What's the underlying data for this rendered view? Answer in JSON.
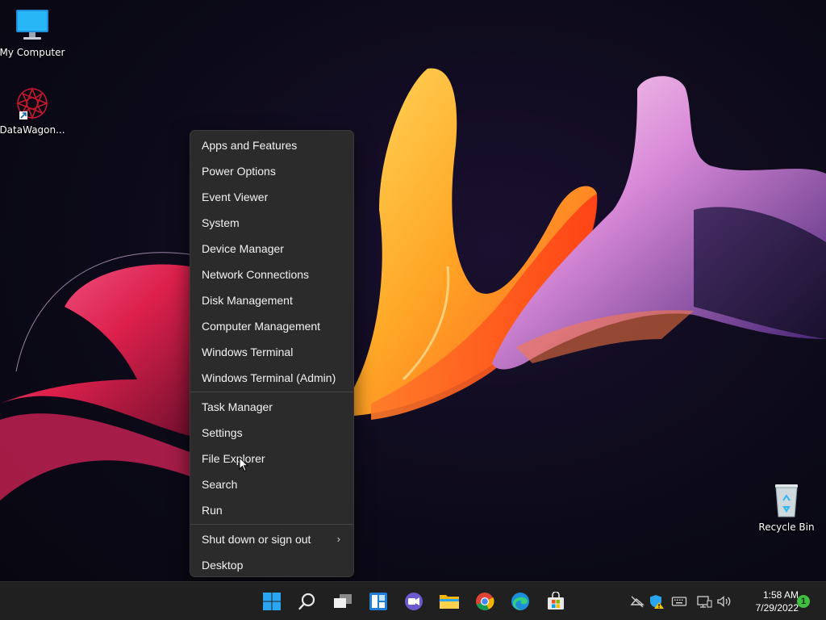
{
  "desktop_icons": [
    {
      "label": "My Computer",
      "icon": "monitor-icon"
    },
    {
      "label": "DataWagon...",
      "icon": "datawagon-logo-icon"
    },
    {
      "label": "Recycle Bin",
      "icon": "recycle-bin-icon"
    }
  ],
  "menu": {
    "groups": [
      [
        "Apps and Features",
        "Power Options",
        "Event Viewer",
        "System",
        "Device Manager",
        "Network Connections",
        "Disk Management",
        "Computer Management",
        "Windows Terminal",
        "Windows Terminal (Admin)"
      ],
      [
        "Task Manager",
        "Settings",
        "File Explorer",
        "Search",
        "Run"
      ],
      [
        "Shut down or sign out",
        "Desktop"
      ]
    ],
    "submenu_indicator": "›"
  },
  "taskbar": {
    "apps": [
      "start-icon",
      "search-icon",
      "task-view-icon",
      "widgets-icon",
      "chat-icon",
      "file-explorer-icon",
      "chrome-icon",
      "edge-icon",
      "store-icon"
    ],
    "tray": [
      "network-off-icon",
      "security-warning-icon",
      "keyboard-icon",
      "display-icon",
      "volume-icon"
    ],
    "time": "1:58 AM",
    "date": "7/29/2022",
    "notifications": "1"
  },
  "colors": {
    "menu_bg": "#2b2b2b",
    "taskbar_bg": "#202020",
    "accent_blue": "#2aa6f0",
    "badge_green": "#3fbf3f"
  }
}
